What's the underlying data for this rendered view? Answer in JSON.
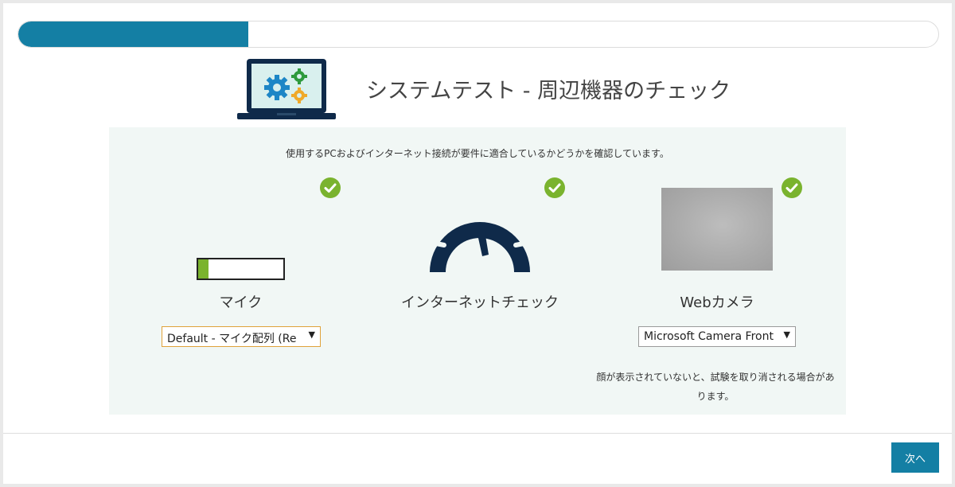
{
  "progress": {
    "fraction": 0.25
  },
  "header": {
    "title": "システムテスト - 周辺機器のチェック"
  },
  "panel": {
    "intro": "使用するPCおよびインターネット接続が要件に適合しているかどうかを確認しています。",
    "microphone": {
      "label": "マイク",
      "level": 0.12,
      "selected_device": "Default - マイク配列 (Re",
      "status": "ok"
    },
    "internet": {
      "label": "インターネットチェック",
      "status": "ok"
    },
    "webcam": {
      "label": "Webカメラ",
      "selected_device": "Microsoft Camera Front",
      "note": "顔が表示されていないと、試験を取り消される場合があります。",
      "status": "ok"
    }
  },
  "footer": {
    "next_label": "次へ"
  },
  "colors": {
    "accent": "#147fa4",
    "check": "#7ab32e",
    "navy": "#0f2a4a",
    "panel_bg": "#f1f7f5"
  },
  "icons": {
    "hero": "laptop-gears-icon",
    "check": "check-circle-icon",
    "internet": "speedometer-icon",
    "dropdown": "dropdown-arrow-icon"
  }
}
